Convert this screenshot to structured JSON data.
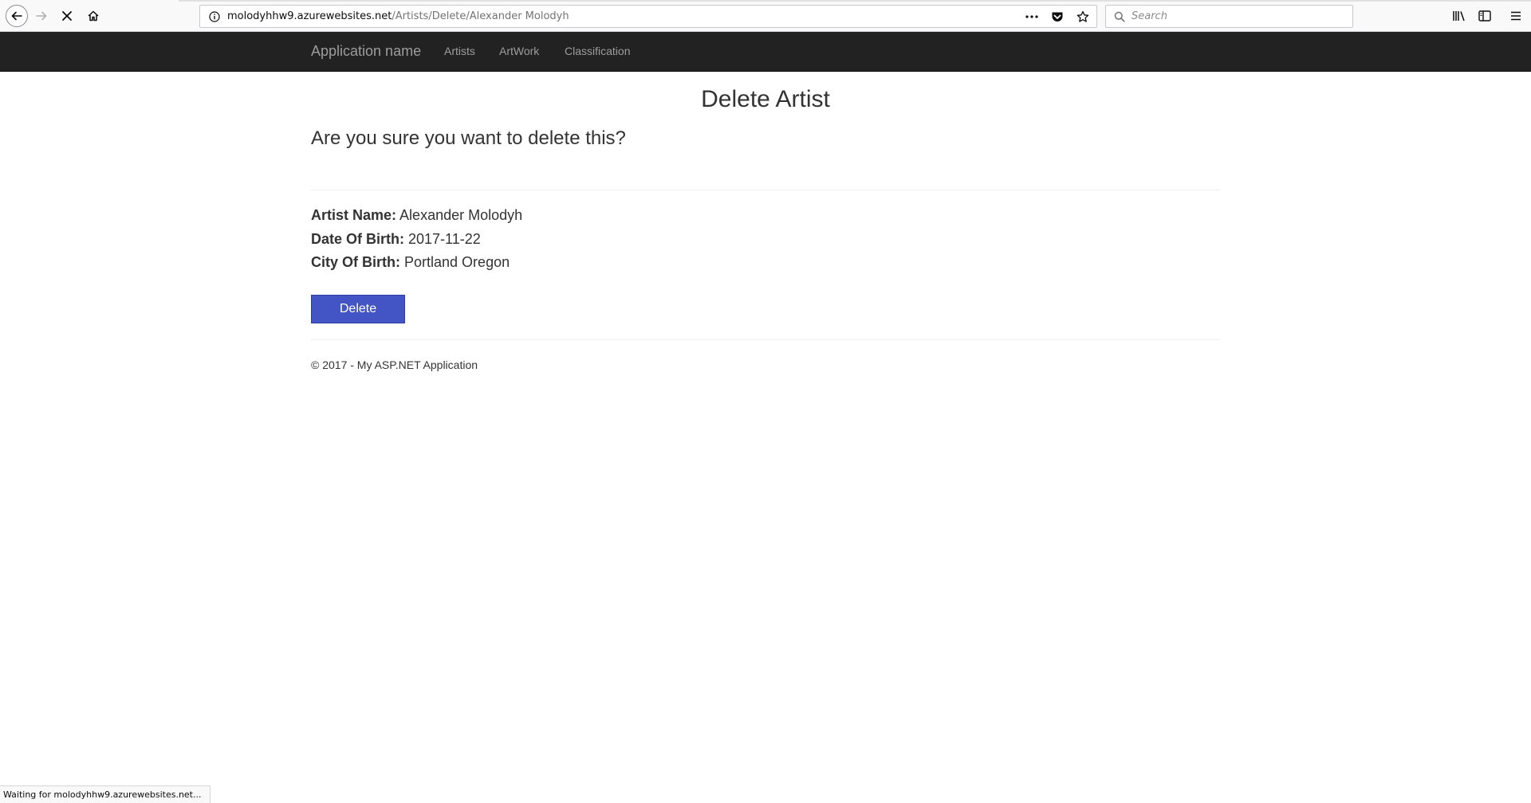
{
  "browser": {
    "url_domain": "molodyhhw9.azurewebsites.net",
    "url_path": "/Artists/Delete/Alexander Molodyh",
    "search_placeholder": "Search",
    "status_text": "Waiting for molodyhhw9.azurewebsites.net...",
    "icons": [
      "back-arrow-icon",
      "forward-arrow-icon",
      "stop-icon",
      "home-icon",
      "info-icon",
      "more-dots-icon",
      "pocket-icon",
      "bookmark-star-icon",
      "search-icon",
      "library-icon",
      "sidebar-icon",
      "hamburger-menu-icon"
    ]
  },
  "navbar": {
    "brand": "Application name",
    "links": [
      "Artists",
      "ArtWork",
      "Classification"
    ],
    "background": "#222222",
    "link_color": "#9d9d9d"
  },
  "page": {
    "title": "Delete Artist",
    "question": "Are you sure you want to delete this?",
    "details": [
      {
        "label": "Artist Name:",
        "value": "Alexander Molodyh"
      },
      {
        "label": "Date Of Birth:",
        "value": "2017-11-22"
      },
      {
        "label": "City Of Birth:",
        "value": "Portland Oregon"
      }
    ],
    "delete_button": "Delete",
    "delete_button_color": "#4355c4",
    "footer": "© 2017 - My ASP.NET Application"
  }
}
